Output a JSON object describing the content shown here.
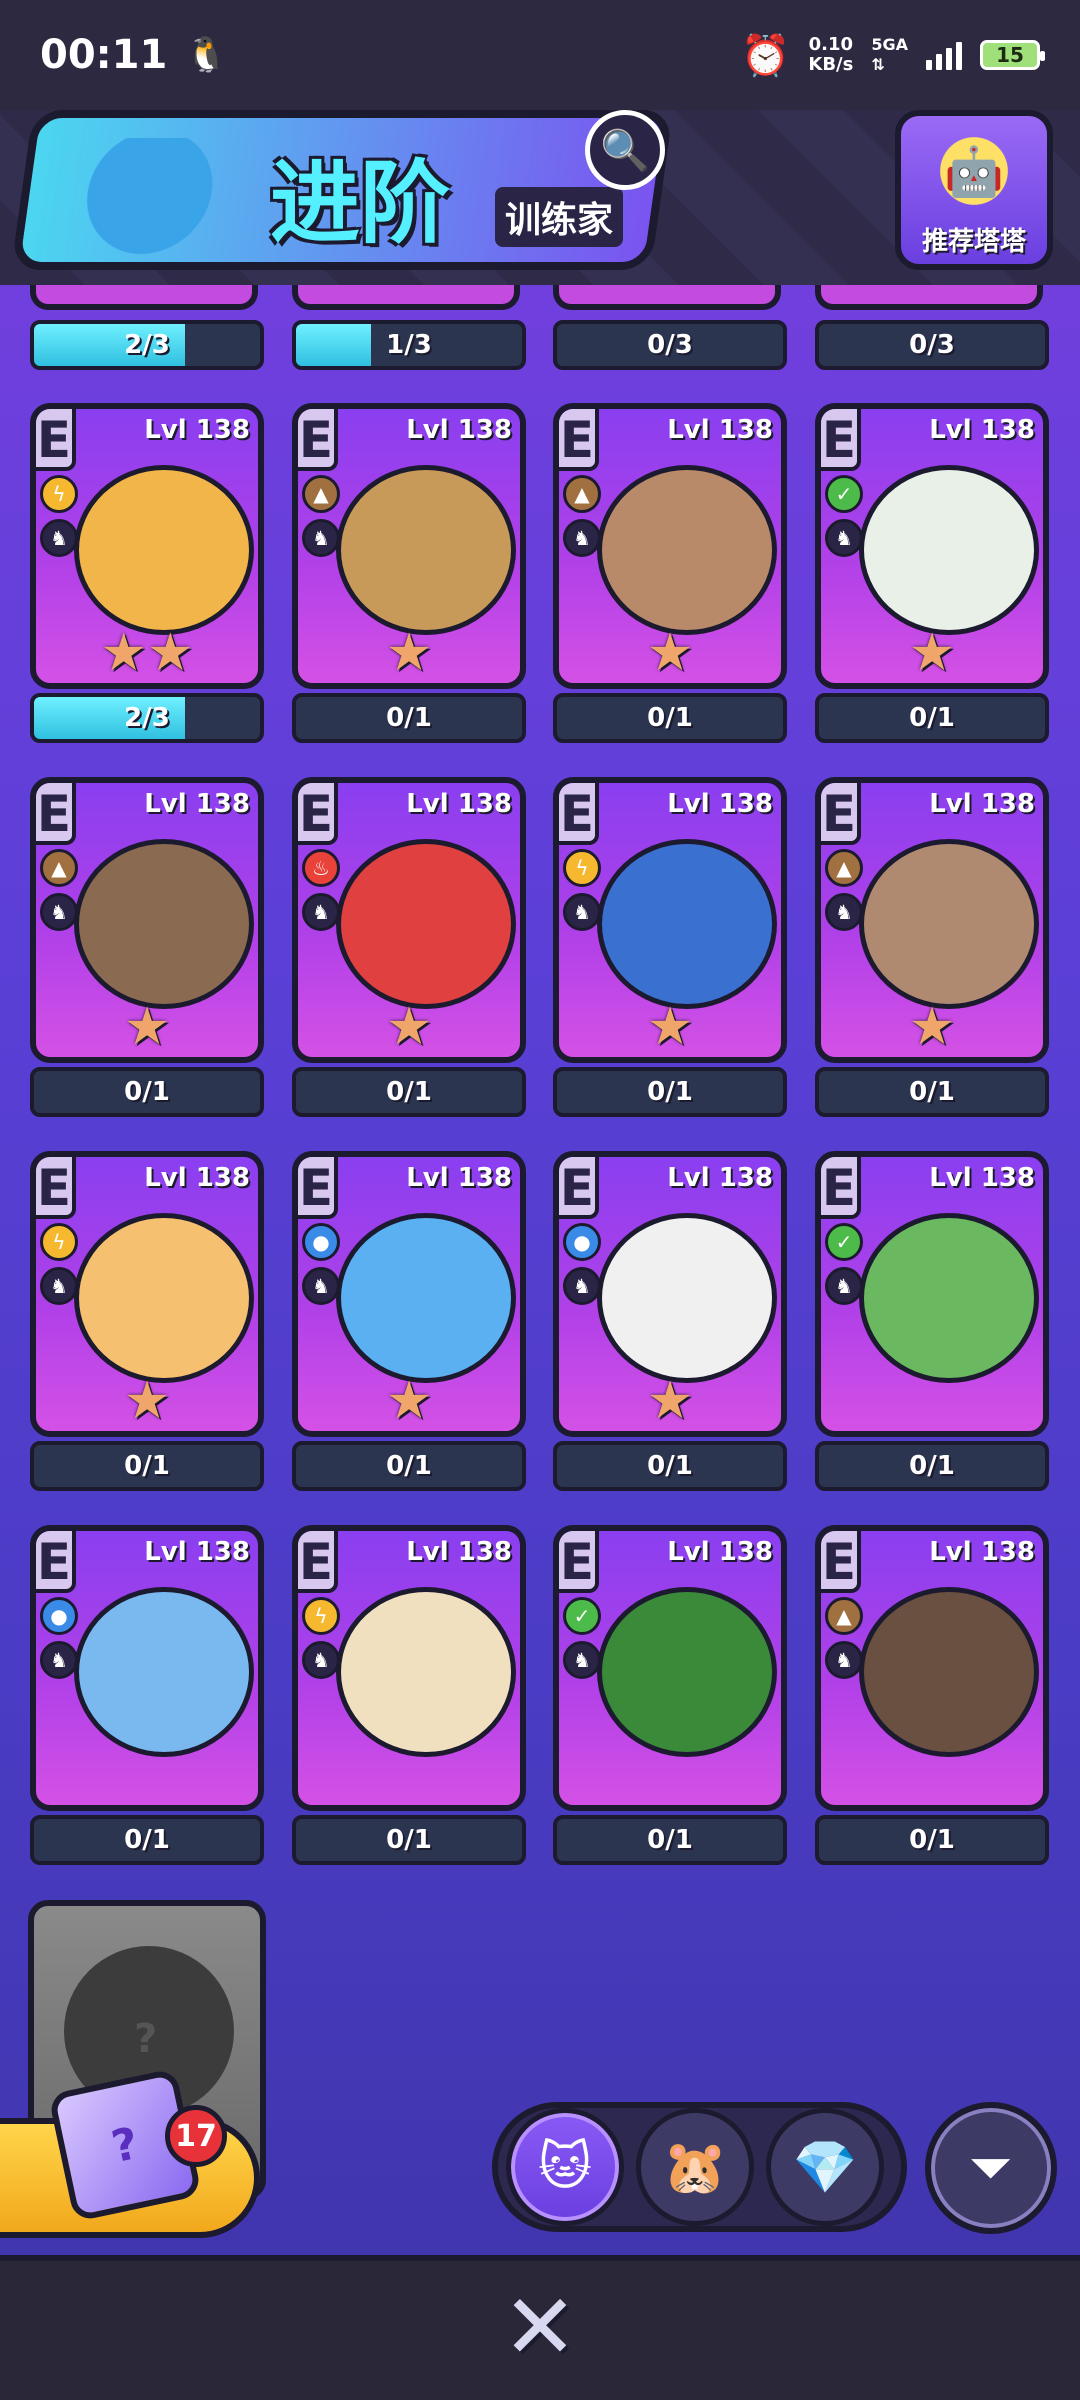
{
  "status": {
    "time": "00:11",
    "speed_value": "0.10",
    "speed_unit": "KB/s",
    "network": "5GA",
    "battery": "15"
  },
  "header": {
    "title": "进阶",
    "subtitle": "训练家",
    "recommend_label": "推荐塔塔"
  },
  "top_progress": [
    {
      "text": "2/3",
      "fill": 0.6667
    },
    {
      "text": "1/3",
      "fill": 0.3333
    },
    {
      "text": "0/3",
      "fill": 0
    },
    {
      "text": "0/3",
      "fill": 0
    }
  ],
  "cards": [
    {
      "grade": "E",
      "level": "Lvl 138",
      "element": "electric",
      "stars": 2,
      "progress": "2/3",
      "fill": 0.6667
    },
    {
      "grade": "E",
      "level": "Lvl 138",
      "element": "earth",
      "stars": 1,
      "progress": "0/1",
      "fill": 0
    },
    {
      "grade": "E",
      "level": "Lvl 138",
      "element": "earth",
      "stars": 1,
      "progress": "0/1",
      "fill": 0
    },
    {
      "grade": "E",
      "level": "Lvl 138",
      "element": "grass",
      "stars": 1,
      "progress": "0/1",
      "fill": 0
    },
    {
      "grade": "E",
      "level": "Lvl 138",
      "element": "earth",
      "stars": 1,
      "progress": "0/1",
      "fill": 0
    },
    {
      "grade": "E",
      "level": "Lvl 138",
      "element": "fire",
      "stars": 1,
      "progress": "0/1",
      "fill": 0
    },
    {
      "grade": "E",
      "level": "Lvl 138",
      "element": "electric",
      "stars": 1,
      "progress": "0/1",
      "fill": 0
    },
    {
      "grade": "E",
      "level": "Lvl 138",
      "element": "earth",
      "stars": 1,
      "progress": "0/1",
      "fill": 0
    },
    {
      "grade": "E",
      "level": "Lvl 138",
      "element": "electric",
      "stars": 1,
      "progress": "0/1",
      "fill": 0
    },
    {
      "grade": "E",
      "level": "Lvl 138",
      "element": "water",
      "stars": 1,
      "progress": "0/1",
      "fill": 0
    },
    {
      "grade": "E",
      "level": "Lvl 138",
      "element": "water",
      "stars": 1,
      "progress": "0/1",
      "fill": 0
    },
    {
      "grade": "E",
      "level": "Lvl 138",
      "element": "grass",
      "stars": 0,
      "progress": "0/1",
      "fill": 0
    },
    {
      "grade": "E",
      "level": "Lvl 138",
      "element": "water",
      "stars": 0,
      "progress": "0/1",
      "fill": 0
    },
    {
      "grade": "E",
      "level": "Lvl 138",
      "element": "electric",
      "stars": 0,
      "progress": "0/1",
      "fill": 0
    },
    {
      "grade": "E",
      "level": "Lvl 138",
      "element": "grass",
      "stars": 0,
      "progress": "0/1",
      "fill": 0
    },
    {
      "grade": "E",
      "level": "Lvl 138",
      "element": "earth",
      "stars": 0,
      "progress": "0/1",
      "fill": 0
    }
  ],
  "locked_card": {
    "mark": "?"
  },
  "gacha": {
    "badge_count": "17",
    "box_mark": "?"
  },
  "icons": {
    "search": "search-icon",
    "close": "close-icon",
    "sort": "filter-sort-icon"
  }
}
